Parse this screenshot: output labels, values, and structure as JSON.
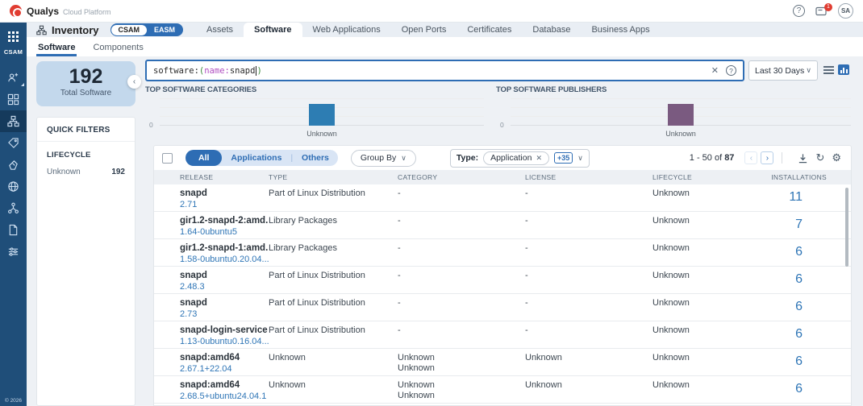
{
  "topbar": {
    "brand": "Qualys",
    "platform": "Cloud Platform",
    "notification_count": "1",
    "avatar_initials": "SA",
    "help_glyph": "?"
  },
  "sidebar": {
    "app_label": "CSAM",
    "copyright": "© 2026"
  },
  "header": {
    "title": "Inventory",
    "toggle_left": "CSAM",
    "toggle_right": "EASM",
    "tabs": [
      {
        "label": "Assets"
      },
      {
        "label": "Software"
      },
      {
        "label": "Web Applications"
      },
      {
        "label": "Open Ports"
      },
      {
        "label": "Certificates"
      },
      {
        "label": "Database"
      },
      {
        "label": "Business Apps"
      }
    ],
    "subtabs": [
      {
        "label": "Software"
      },
      {
        "label": "Components"
      }
    ]
  },
  "summary_card": {
    "count": "192",
    "label": "Total Software"
  },
  "quick_filters": {
    "title": "QUICK FILTERS",
    "section_title": "LIFECYCLE",
    "items": [
      {
        "label": "Unknown",
        "count": "192"
      }
    ]
  },
  "search": {
    "token_field": "software:",
    "token_open": "(",
    "token_key": "name:",
    "token_value": "snapd",
    "token_close": ")",
    "clear_glyph": "✕",
    "date_range": "Last 30 Days"
  },
  "chart_data": [
    {
      "type": "bar",
      "title": "TOP SOFTWARE CATEGORIES",
      "categories": [
        "Unknown"
      ],
      "values": [
        192
      ],
      "bar_color": "#2d7db3",
      "y_origin_tick": "0",
      "grid": true,
      "legend": false
    },
    {
      "type": "bar",
      "title": "TOP SOFTWARE PUBLISHERS",
      "categories": [
        "Unknown"
      ],
      "values": [
        192
      ],
      "bar_color": "#7a5a80",
      "y_origin_tick": "0",
      "grid": true,
      "legend": false
    }
  ],
  "toolbar": {
    "segments": [
      {
        "label": "All"
      },
      {
        "label": "Applications"
      },
      {
        "label": "Others"
      }
    ],
    "group_by_label": "Group By",
    "type_label": "Type:",
    "type_chip": "Application",
    "type_more": "+35",
    "pagination_range": "1 - 50 of",
    "pagination_total": "87"
  },
  "table": {
    "columns": [
      {
        "label": "RELEASE"
      },
      {
        "label": "TYPE"
      },
      {
        "label": "CATEGORY"
      },
      {
        "label": "LICENSE"
      },
      {
        "label": "LIFECYCLE"
      },
      {
        "label": "INSTALLATIONS"
      }
    ],
    "rows": [
      {
        "name": "snapd",
        "version": "2.71",
        "type": "Part of Linux Distribution",
        "category": "-",
        "category2": "",
        "license": "-",
        "lifecycle": "Unknown",
        "installations": "11"
      },
      {
        "name": "gir1.2-snapd-2:amd...",
        "version": "1.64-0ubuntu5",
        "type": "Library Packages",
        "category": "-",
        "category2": "",
        "license": "-",
        "lifecycle": "Unknown",
        "installations": "7"
      },
      {
        "name": "gir1.2-snapd-1:amd...",
        "version": "1.58-0ubuntu0.20.04...",
        "type": "Library Packages",
        "category": "-",
        "category2": "",
        "license": "-",
        "lifecycle": "Unknown",
        "installations": "6"
      },
      {
        "name": "snapd",
        "version": "2.48.3",
        "type": "Part of Linux Distribution",
        "category": "-",
        "category2": "",
        "license": "-",
        "lifecycle": "Unknown",
        "installations": "6"
      },
      {
        "name": "snapd",
        "version": "2.73",
        "type": "Part of Linux Distribution",
        "category": "-",
        "category2": "",
        "license": "-",
        "lifecycle": "Unknown",
        "installations": "6"
      },
      {
        "name": "snapd-login-service",
        "version": "1.13-0ubuntu0.16.04...",
        "type": "Part of Linux Distribution",
        "category": "-",
        "category2": "",
        "license": "-",
        "lifecycle": "Unknown",
        "installations": "6"
      },
      {
        "name": "snapd:amd64",
        "version": "2.67.1+22.04",
        "type": "Unknown",
        "category": "Unknown",
        "category2": "Unknown",
        "license": "Unknown",
        "lifecycle": "Unknown",
        "installations": "6"
      },
      {
        "name": "snapd:amd64",
        "version": "2.68.5+ubuntu24.04.1",
        "type": "Unknown",
        "category": "Unknown",
        "category2": "Unknown",
        "license": "Unknown",
        "lifecycle": "Unknown",
        "installations": "6"
      }
    ]
  }
}
